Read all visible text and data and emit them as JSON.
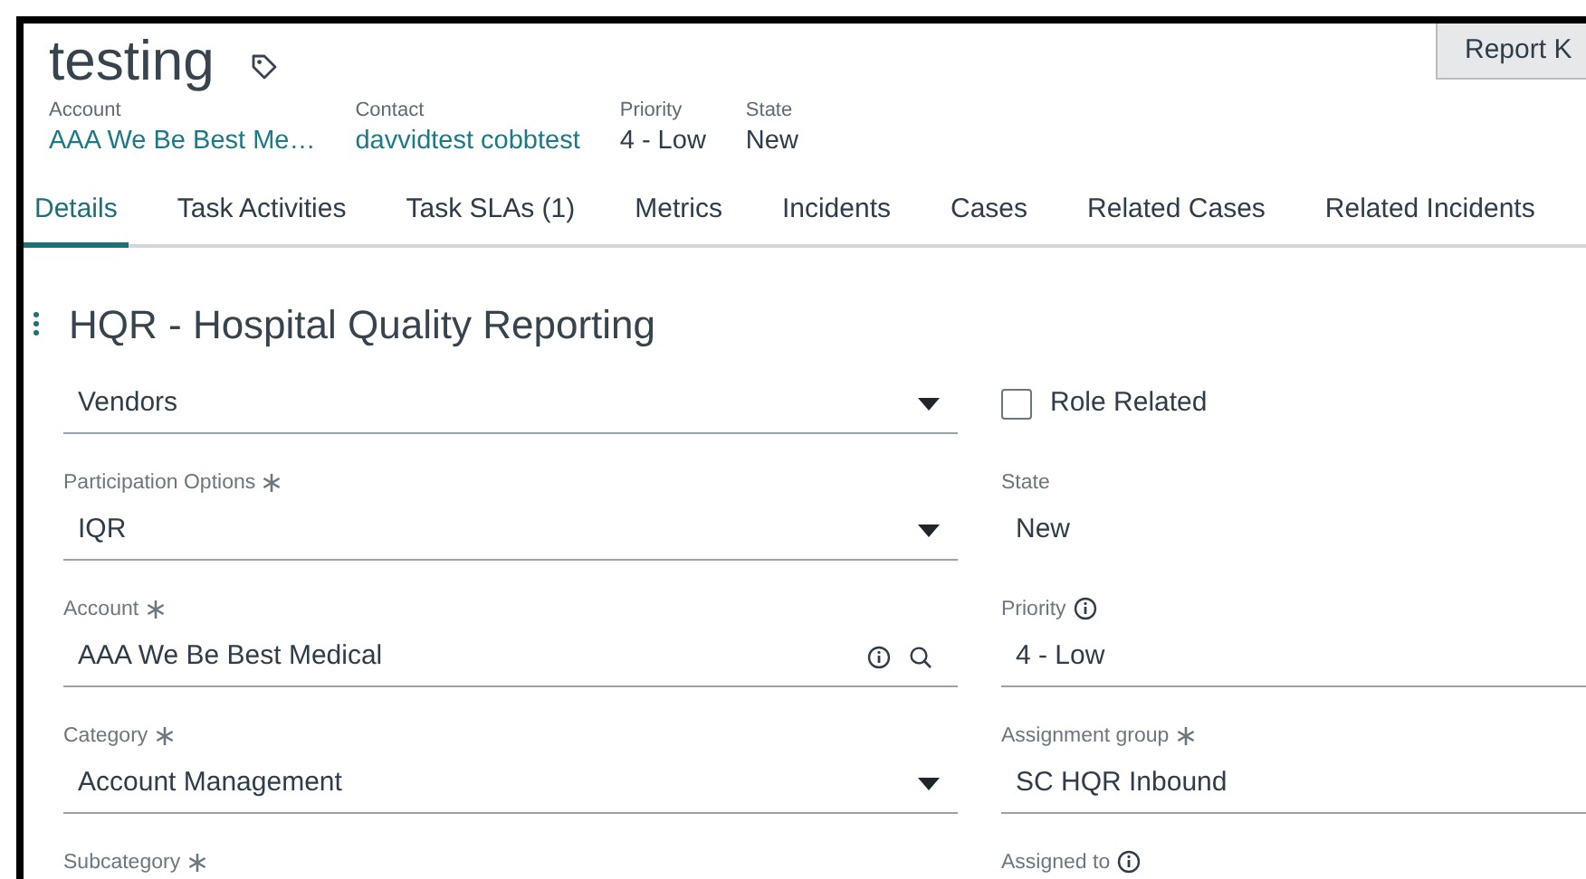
{
  "header": {
    "title": "testing",
    "meta": [
      {
        "label": "Account",
        "value": "AAA We Be Best Me…",
        "kind": "link"
      },
      {
        "label": "Contact",
        "value": "davvidtest cobbtest",
        "kind": "link"
      },
      {
        "label": "Priority",
        "value": "4 - Low",
        "kind": "plain"
      },
      {
        "label": "State",
        "value": "New",
        "kind": "plain"
      }
    ]
  },
  "report_button": {
    "label": "Report K"
  },
  "tabs": [
    {
      "label": "Details",
      "selected": true
    },
    {
      "label": "Task Activities",
      "selected": false
    },
    {
      "label": "Task SLAs (1)",
      "selected": false
    },
    {
      "label": "Metrics",
      "selected": false
    },
    {
      "label": "Incidents",
      "selected": false
    },
    {
      "label": "Cases",
      "selected": false
    },
    {
      "label": "Related Cases",
      "selected": false
    },
    {
      "label": "Related Incidents",
      "selected": false
    }
  ],
  "section": {
    "title": "HQR - Hospital Quality Reporting",
    "rows": [
      {
        "left": {
          "kind": "select",
          "value": "Vendors"
        },
        "right": {
          "kind": "checkbox",
          "label": "Role Related",
          "checked": false
        }
      },
      {
        "left": {
          "kind": "select",
          "label": "Participation Options",
          "required": true,
          "value": "IQR"
        },
        "right": {
          "kind": "readonly",
          "label": "State",
          "value": "New"
        }
      },
      {
        "left": {
          "kind": "lookup",
          "label": "Account",
          "required": true,
          "value": "AAA We Be Best Medical"
        },
        "right": {
          "kind": "text",
          "label": "Priority",
          "info": true,
          "value": "4 - Low"
        }
      },
      {
        "left": {
          "kind": "select",
          "label": "Category",
          "required": true,
          "value": "Account Management"
        },
        "right": {
          "kind": "text",
          "label": "Assignment group",
          "required": true,
          "value": "SC HQR Inbound"
        }
      },
      {
        "left": {
          "kind": "label",
          "label": "Subcategory",
          "required": true
        },
        "right": {
          "kind": "label",
          "label": "Assigned to",
          "info": true
        }
      }
    ]
  }
}
